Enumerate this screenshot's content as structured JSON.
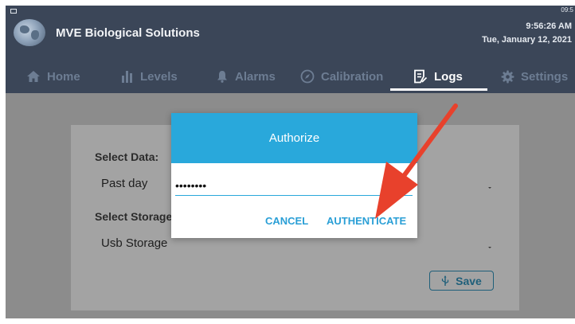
{
  "app": {
    "company": "MVE Biological Solutions",
    "time": "9:56:26 AM",
    "date": "Tue, January 12, 2021",
    "status_bar": "09:5"
  },
  "nav": {
    "tabs": [
      {
        "label": "Home",
        "icon": "home-icon"
      },
      {
        "label": "Levels",
        "icon": "levels-icon"
      },
      {
        "label": "Alarms",
        "icon": "bell-icon"
      },
      {
        "label": "Calibration",
        "icon": "compass-icon"
      },
      {
        "label": "Logs",
        "icon": "logs-icon",
        "active": true
      },
      {
        "label": "Settings",
        "icon": "gear-icon"
      }
    ]
  },
  "form": {
    "select_data_label": "Select Data:",
    "select_data_value": "Past day",
    "select_storage_label": "Select Storage",
    "select_storage_value": "Usb Storage",
    "save_label": "Save",
    "save_icon": "usb-icon"
  },
  "dialog": {
    "title": "Authorize",
    "password_value": "••••••••",
    "cancel_label": "CANCEL",
    "authenticate_label": "AUTHENTICATE"
  },
  "colors": {
    "appbar": "#3b4658",
    "accent": "#29a8db",
    "annotation_arrow": "#e8412c",
    "overlay": "#8c8c8c"
  }
}
